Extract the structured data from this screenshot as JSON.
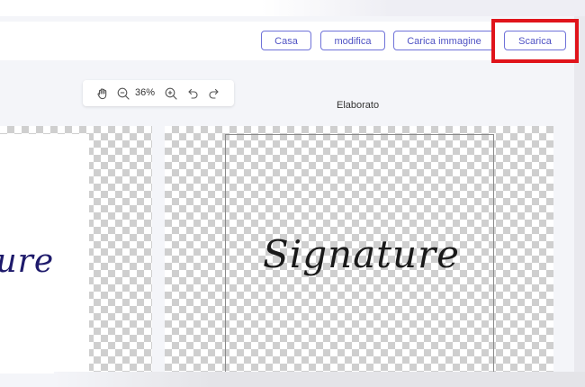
{
  "toolbar": {
    "buttons": [
      {
        "label": "Casa"
      },
      {
        "label": "modifica"
      },
      {
        "label": "Carica immagine"
      },
      {
        "label": "Scarica"
      }
    ],
    "accent_color": "#6f72d9",
    "highlight_color": "#e0141b"
  },
  "zoom": {
    "level": "36%",
    "icons": [
      "hand-icon",
      "zoom-out-icon",
      "zoom-in-icon",
      "undo-icon",
      "redo-icon"
    ]
  },
  "panels": {
    "processed_label": "Elaborato",
    "original_signature_text": "ture",
    "result_signature_text": "Signature"
  }
}
